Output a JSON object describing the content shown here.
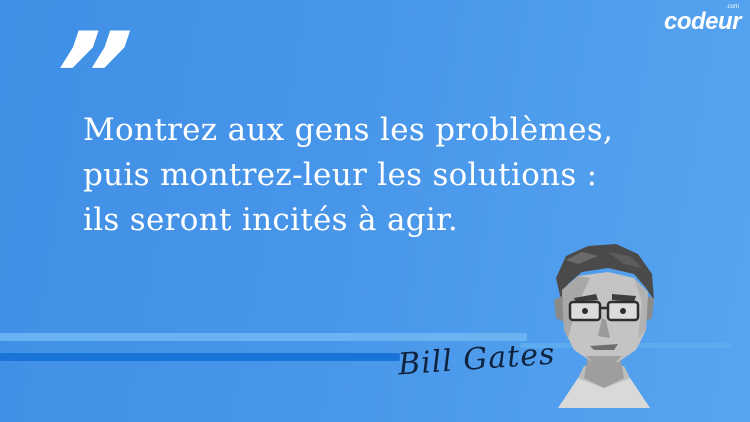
{
  "brand": {
    "logo": "codeur",
    "logo_sup": ".com"
  },
  "quote_mark": "”",
  "quote_lines": [
    "Montrez aux gens les problèmes,",
    "puis montrez-leur les solutions :",
    "ils seront incités à agir."
  ],
  "author_signature": "Bill Gates",
  "colors": {
    "background": "#4896ea",
    "text": "#ffffff",
    "stripe_dark": "#1a74d8",
    "stripe_light": "#6ab3f2"
  },
  "icons": {
    "quote": "quote-mark-icon",
    "portrait": "portrait-illustration"
  }
}
